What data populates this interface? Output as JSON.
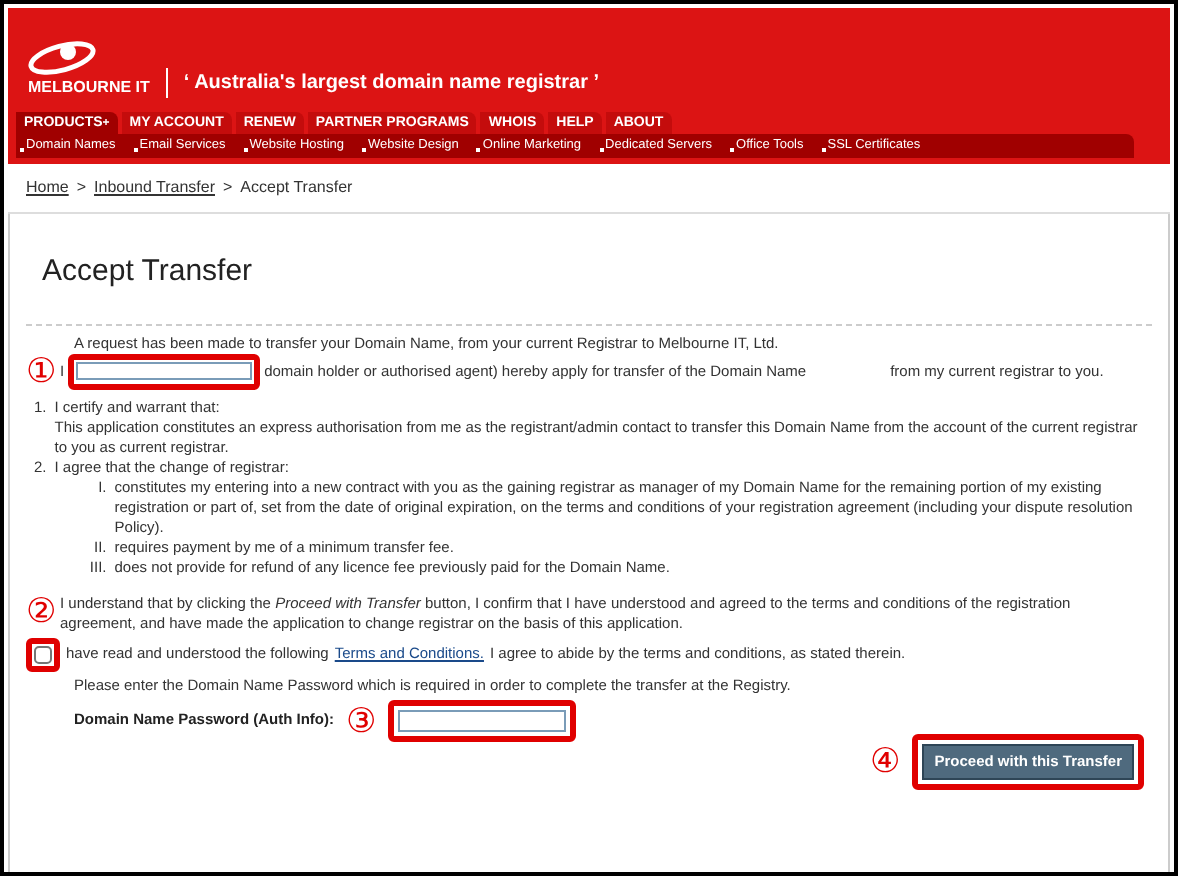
{
  "header": {
    "logo": "MELBOURNE IT",
    "tagline": "‘ Australia's largest domain name registrar ’"
  },
  "nav": [
    {
      "label": "PRODUCTS",
      "selected": true,
      "caret": "+"
    },
    {
      "label": "MY ACCOUNT",
      "selected": false
    },
    {
      "label": "RENEW",
      "selected": false
    },
    {
      "label": "PARTNER PROGRAMS",
      "selected": false
    },
    {
      "label": "WHOIS",
      "selected": false
    },
    {
      "label": "HELP",
      "selected": false
    },
    {
      "label": "ABOUT",
      "selected": false
    }
  ],
  "subnav": [
    "Domain Names",
    "Email Services",
    "Website Hosting",
    "Website Design",
    "Online Marketing",
    "Dedicated Servers",
    "Office Tools",
    "SSL Certificates"
  ],
  "breadcrumb": [
    {
      "label": "Home",
      "link": true
    },
    {
      "label": ">",
      "link": false
    },
    {
      "label": "Inbound Transfer",
      "link": true
    },
    {
      "label": ">",
      "link": false
    },
    {
      "label": "Accept Transfer",
      "link": false
    }
  ],
  "title": "Accept Transfer",
  "intro": "A request has been made to transfer your Domain Name, from your current Registrar to Melbourne IT, Ltd.",
  "applicant": {
    "before": "I",
    "after": "domain holder or authorised agent) hereby apply for transfer of the Domain Name",
    "end": "from my current registrar to you.",
    "marker": "①"
  },
  "clauses": [
    {
      "number": "1.",
      "text": "I certify and warrant that:",
      "detail": "This application constitutes an express authorisation from me as the registrant/admin contact to transfer this Domain Name from the account of the current registrar to you as current registrar."
    },
    {
      "number": "2.",
      "text": "I agree that the change of registrar:",
      "items": [
        {
          "number": "I.",
          "text": "constitutes my entering into a new contract with you as the gaining registrar as manager of my Domain Name for the remaining portion of my existing registration or part of, set from the date of original expiration, on the terms and conditions of your registration agreement (including your dispute resolution Policy)."
        },
        {
          "number": "II.",
          "text": "requires payment by me of a minimum transfer fee."
        },
        {
          "number": "III.",
          "text": "does not provide for refund of any licence fee previously paid for the Domain Name."
        }
      ]
    }
  ],
  "understand": {
    "marker": "②",
    "text": "I understand that by clicking the *Proceed with Transfer* button, I confirm that I have understood and agreed to the terms and conditions of the registration agreement, and have made the application to change registrar on the basis of this application."
  },
  "terms": {
    "checked": false,
    "before": "have read and understood the following",
    "link": "Terms and Conditions.",
    "after": "I agree to abide by the terms and conditions, as stated therein."
  },
  "password_hint": "Please enter the Domain Name Password which is required in order to complete the transfer at the Registry.",
  "password": {
    "label": "Domain Name Password (Auth Info):",
    "marker": "③"
  },
  "submit": {
    "label": "Proceed with this Transfer",
    "marker": "④"
  }
}
